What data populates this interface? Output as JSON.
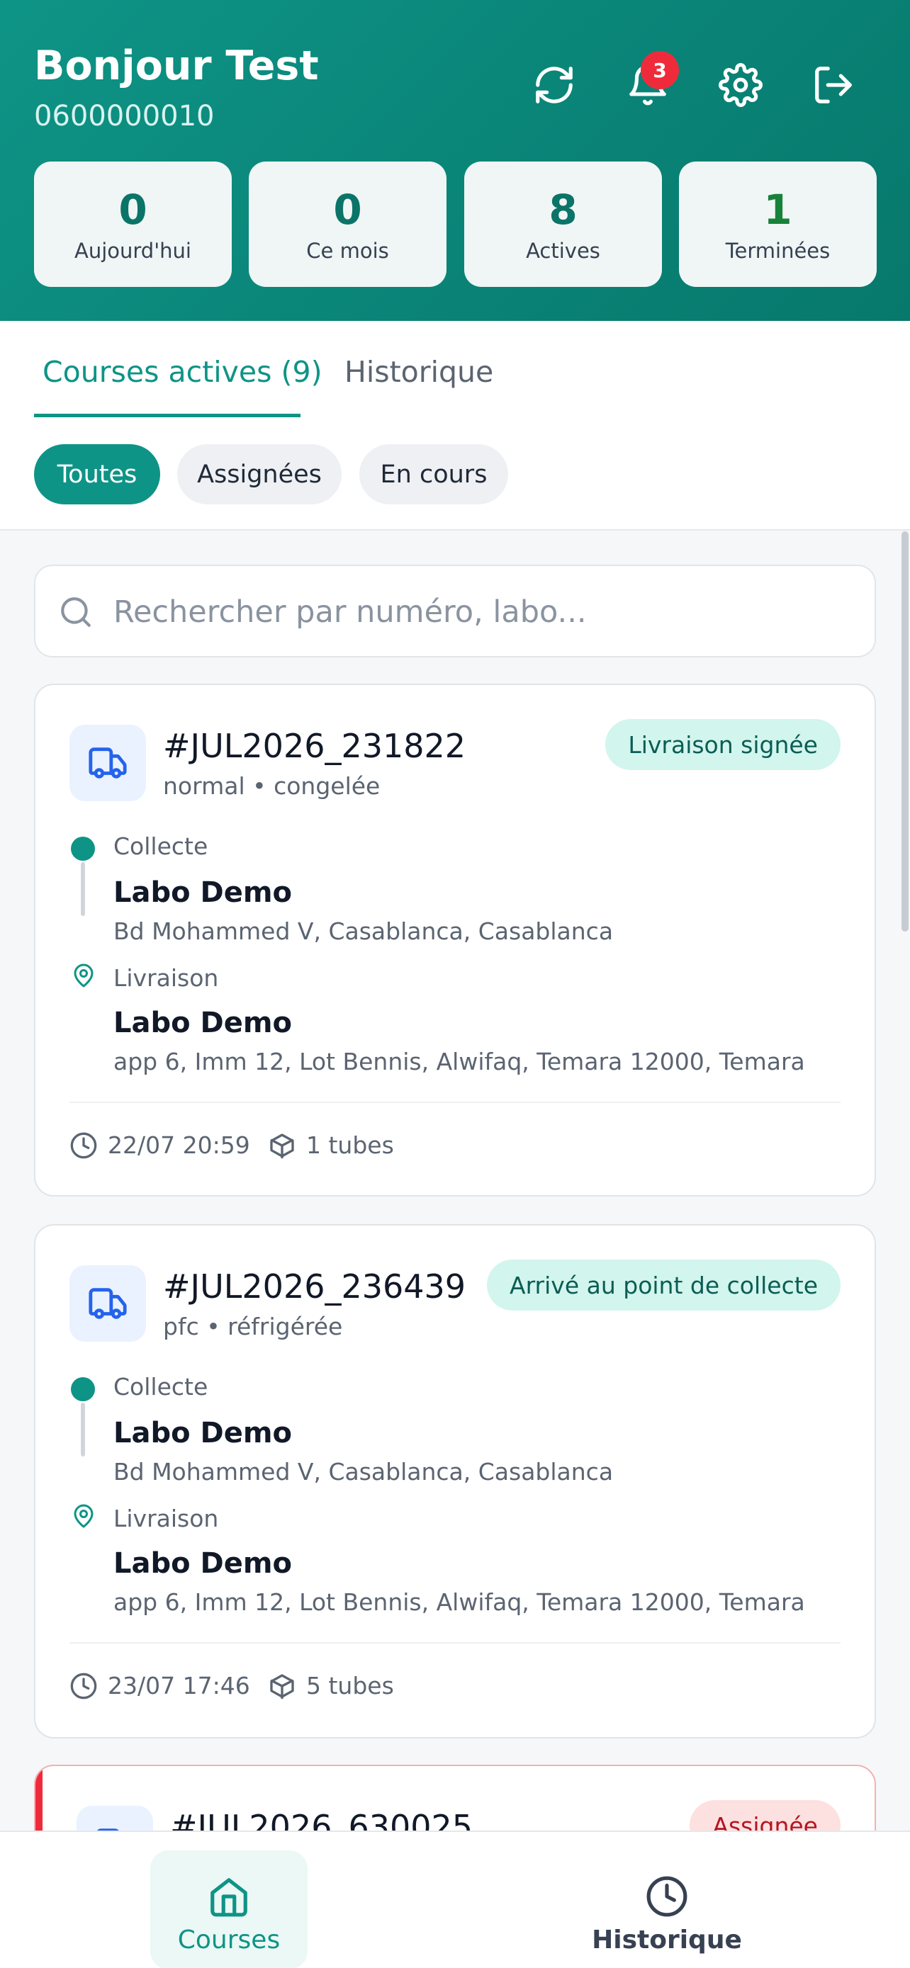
{
  "header": {
    "greeting": "Bonjour Test",
    "phone": "0600000010",
    "notification_count": "3",
    "icons": [
      "refresh-icon",
      "bell-icon",
      "gear-icon",
      "logout-icon"
    ]
  },
  "stats": [
    {
      "value": "0",
      "label": "Aujourd'hui"
    },
    {
      "value": "0",
      "label": "Ce mois"
    },
    {
      "value": "8",
      "label": "Actives"
    },
    {
      "value": "1",
      "label": "Terminées"
    }
  ],
  "tabs": [
    {
      "label": "Courses actives (9)",
      "active": true
    },
    {
      "label": "Historique",
      "active": false
    }
  ],
  "filters": [
    {
      "label": "Toutes",
      "active": true
    },
    {
      "label": "Assignées",
      "active": false
    },
    {
      "label": "En cours",
      "active": false
    }
  ],
  "search": {
    "placeholder": "Rechercher par numéro, labo...",
    "value": ""
  },
  "courses": [
    {
      "number": "#JUL2026_231822",
      "meta": "normal • congelée",
      "status": "Livraison signée",
      "pickup_label": "Collecte",
      "pickup_name": "Labo Demo",
      "pickup_address": "Bd Mohammed V, Casablanca, Casablanca",
      "delivery_label": "Livraison",
      "delivery_name": "Labo Demo",
      "delivery_address": "app 6, Imm 12, Lot Bennis, Alwifaq, Temara 12000, Temara",
      "datetime": "22/07 20:59",
      "tubes": "1 tubes"
    },
    {
      "number": "#JUL2026_236439",
      "meta": "pfc • réfrigérée",
      "status": "Arrivé au point de collecte",
      "pickup_label": "Collecte",
      "pickup_name": "Labo Demo",
      "pickup_address": "Bd Mohammed V, Casablanca, Casablanca",
      "delivery_label": "Livraison",
      "delivery_name": "Labo Demo",
      "delivery_address": "app 6, Imm 12, Lot Bennis, Alwifaq, Temara 12000, Temara",
      "datetime": "23/07 17:46",
      "tubes": "5 tubes"
    },
    {
      "number": "#JUL2026_630025",
      "status": "Assignée"
    }
  ],
  "bottom_nav": [
    {
      "label": "Courses",
      "icon": "home-icon",
      "active": true
    },
    {
      "label": "Historique",
      "icon": "clock-icon",
      "active": false
    }
  ],
  "colors": {
    "primary": "#0e9486",
    "accent_red": "#ef2b3b",
    "status_green_bg": "#d2f5ee"
  }
}
